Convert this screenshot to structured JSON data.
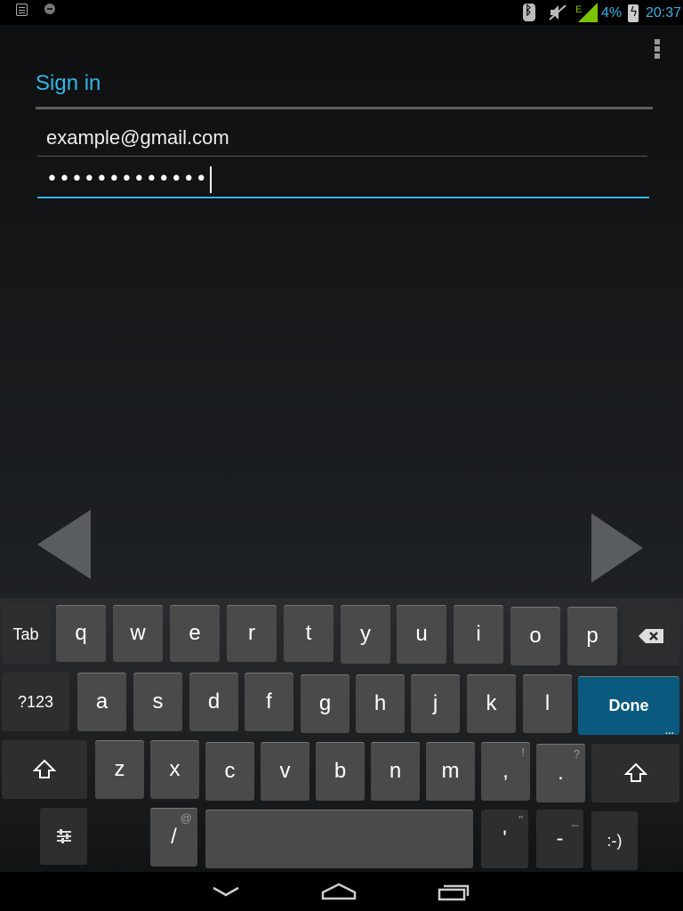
{
  "status_bar": {
    "battery_percent": "4%",
    "clock": "20:37",
    "signal_label": "E",
    "icons": [
      "tab-notification-icon",
      "sync-notification-icon",
      "bluetooth-icon",
      "mute-icon",
      "signal-icon",
      "battery-icon"
    ]
  },
  "sign_in": {
    "title": "Sign in",
    "email_value": "example@gmail.com",
    "password_value": "•••••••••••••"
  },
  "keyboard": {
    "row1": [
      "q",
      "w",
      "e",
      "r",
      "t",
      "y",
      "u",
      "i",
      "o",
      "p"
    ],
    "row2": [
      "a",
      "s",
      "d",
      "f",
      "g",
      "h",
      "j",
      "k",
      "l"
    ],
    "row3": [
      "z",
      "x",
      "c",
      "v",
      "b",
      "n",
      "m",
      ",",
      "."
    ],
    "row3_hints": [
      "!",
      "?"
    ],
    "tab_label": "Tab",
    "symbols_label": "?123",
    "done_label": "Done",
    "slash_label": "/",
    "slash_hint": "@",
    "apostrophe_label": "'",
    "apostrophe_hint": "\"",
    "dash_label": "-",
    "dash_hint": "_",
    "smiley_label": ":-)"
  },
  "colors": {
    "accent": "#33b5e5",
    "done_key": "#0a5a80",
    "key": "#4a4a4a"
  }
}
